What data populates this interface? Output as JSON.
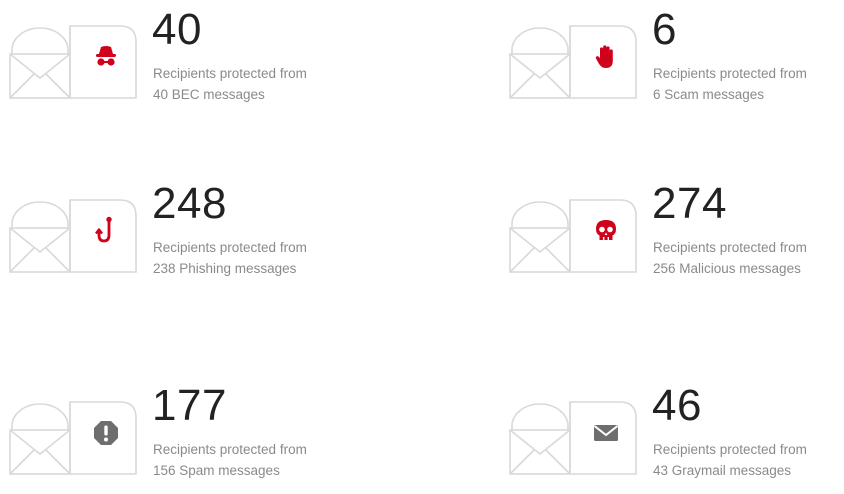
{
  "colors": {
    "accent_red": "#d0021b",
    "gray_icon": "#6e6e6e",
    "outline": "#d9d9d9"
  },
  "cards": [
    {
      "count": "40",
      "line1": "Recipients protected from",
      "line2": "40 BEC messages",
      "icon": "spy-incognito-icon"
    },
    {
      "count": "6",
      "line1": "Recipients protected from",
      "line2": "6 Scam messages",
      "icon": "stop-hand-icon"
    },
    {
      "count": "248",
      "line1": "Recipients protected from",
      "line2": "238 Phishing messages",
      "icon": "fish-hook-icon"
    },
    {
      "count": "274",
      "line1": "Recipients protected from",
      "line2": "256 Malicious messages",
      "icon": "skull-icon"
    },
    {
      "count": "177",
      "line1": "Recipients protected from",
      "line2": "156 Spam messages",
      "icon": "exclamation-octagon-icon"
    },
    {
      "count": "46",
      "line1": "Recipients protected from",
      "line2": "43 Graymail messages",
      "icon": "mail-icon"
    }
  ]
}
